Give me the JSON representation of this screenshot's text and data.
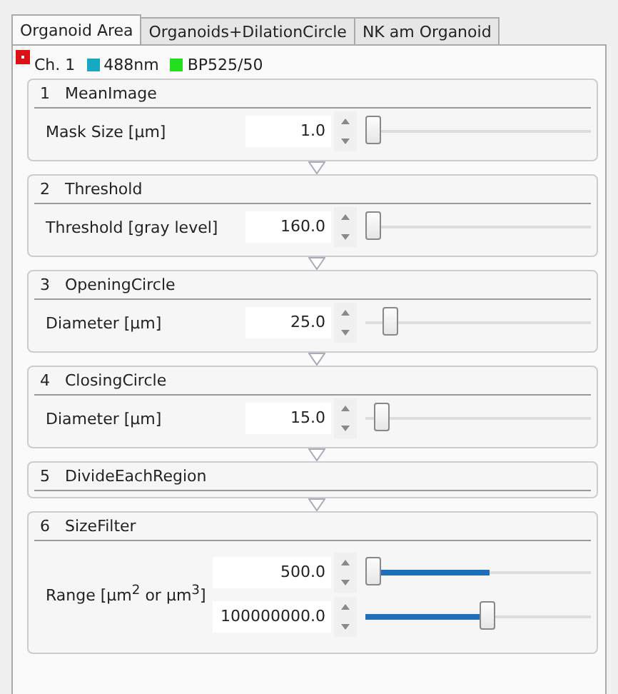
{
  "tabs": [
    {
      "label": "Organoid Area",
      "selected": true
    },
    {
      "label": "Organoids+DilationCircle",
      "selected": false
    },
    {
      "label": "NK am Organoid",
      "selected": false
    }
  ],
  "channel": {
    "label": "Ch. 1",
    "legend": [
      {
        "label": "488nm",
        "color": "#17a9c4"
      },
      {
        "label": "BP525/50",
        "color": "#22e01e"
      }
    ]
  },
  "steps": [
    {
      "number": "1",
      "title": "MeanImage",
      "rows": [
        {
          "kind": "single",
          "label": "Mask Size [µm]",
          "fields": [
            {
              "value": "1.0",
              "level": 0
            }
          ]
        }
      ]
    },
    {
      "number": "2",
      "title": "Threshold",
      "rows": [
        {
          "kind": "single",
          "label": "Threshold [gray level]",
          "fields": [
            {
              "value": "160.0",
              "level": 0
            }
          ]
        }
      ]
    },
    {
      "number": "3",
      "title": "OpeningCircle",
      "rows": [
        {
          "kind": "single",
          "label": "Diameter [µm]",
          "fields": [
            {
              "value": "25.0",
              "level": 0.08
            }
          ]
        }
      ]
    },
    {
      "number": "4",
      "title": "ClosingCircle",
      "rows": [
        {
          "kind": "single",
          "label": "Diameter [µm]",
          "fields": [
            {
              "value": "15.0",
              "level": 0.04
            }
          ]
        }
      ]
    },
    {
      "number": "5",
      "title": "DivideEachRegion"
    },
    {
      "number": "6",
      "title": "SizeFilter",
      "rows": [
        {
          "kind": "range",
          "label": "Range [µm$^{2}$ or µm$^{3}$]",
          "fields": [
            {
              "value": "500.0",
              "level": 0
            },
            {
              "value": "100000000.0",
              "level": 0.55
            }
          ]
        }
      ]
    }
  ]
}
